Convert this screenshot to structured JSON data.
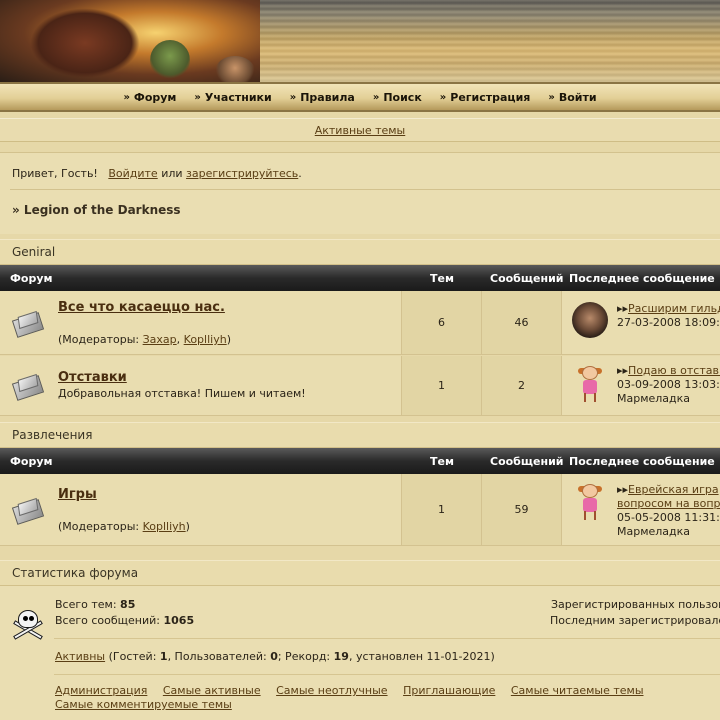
{
  "nav": {
    "items": [
      {
        "label": "Форум"
      },
      {
        "label": "Участники"
      },
      {
        "label": "Правила"
      },
      {
        "label": "Поиск"
      },
      {
        "label": "Регистрация"
      },
      {
        "label": "Войти"
      }
    ],
    "chevron": "»"
  },
  "active_topics": "Активные темы",
  "greeting": {
    "prefix": "Привет, Гость!",
    "login": "Войдите",
    "or": "или",
    "register": "зарегистрируйтесь",
    "dot": "."
  },
  "breadcrumb": "» Legion of the Darkness",
  "categories": [
    {
      "title": "Geniral",
      "headers": {
        "forum": "Форум",
        "topics": "Тем",
        "posts": "Сообщений",
        "last": "Последнее сообщение"
      },
      "forums": [
        {
          "name": "Все что касаеццо нас.",
          "mods_prefix": "(Модераторы: ",
          "mod1": "Захар",
          "comma": ", ",
          "mod2": "Koplliyh",
          "mods_suffix": ")",
          "topics": "6",
          "posts": "46",
          "last_title": "Расширим гильдию",
          "last_date": "27-03-2008 18:09:",
          "last_user": ""
        },
        {
          "name": "Отставки",
          "description": "Добравольная отставка! Пишем и читаем!",
          "topics": "1",
          "posts": "2",
          "last_title": "Подаю в отставку",
          "last_date": "03-09-2008 13:03:",
          "last_user": "Мармеладка"
        }
      ]
    },
    {
      "title": "Развлечения",
      "headers": {
        "forum": "Форум",
        "topics": "Тем",
        "posts": "Сообщений",
        "last": "Последнее сообщение"
      },
      "forums": [
        {
          "name": "Игры",
          "mods_prefix": "(Модераторы: ",
          "mod1": "Koplliyh",
          "mods_suffix": ")",
          "topics": "1",
          "posts": "59",
          "last_title_line1": "Еврейская игра",
          "last_title_line2": "вопросом на вопрос",
          "last_date": "05-05-2008 11:31:",
          "last_user": "Мармеладка"
        }
      ]
    }
  ],
  "stats": {
    "title": "Статистика форума",
    "total_topics_label": "Всего тем: ",
    "total_topics": "85",
    "total_posts_label": "Всего сообщений: ",
    "total_posts": "1065",
    "registered_label": "Зарегистрированных пользователей",
    "last_registered_label": "Последним зарегистрировался",
    "active_link": "Активны",
    "guests_prefix": " (Гостей: ",
    "guests": "1",
    "users_prefix": ", Пользователей: ",
    "users": "0",
    "record_prefix": "; Рекорд: ",
    "record": "19",
    "record_suffix": ", установлен 11-01-2021)",
    "links": [
      "Администрация",
      "Самые активные",
      "Самые неотлучные",
      "Приглашающие",
      "Самые читаемые темы"
    ],
    "links2": [
      "Самые комментируемые темы"
    ]
  }
}
